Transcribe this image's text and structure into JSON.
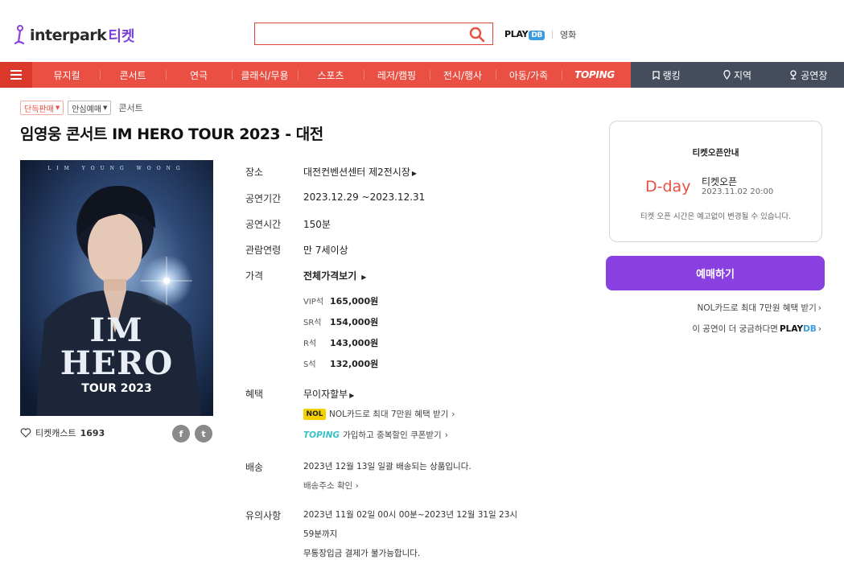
{
  "header": {
    "logo_text": "interpark",
    "logo_suffix": "티켓",
    "search_value": "",
    "playdb_label": "PLAY",
    "playdb_badge": "DB",
    "movie_label": "영화"
  },
  "nav": {
    "items": [
      "뮤지컬",
      "콘서트",
      "연극",
      "클래식/무용",
      "스포츠",
      "레저/캠핑",
      "전시/행사",
      "아동/가족",
      "TOPING"
    ],
    "right_items": [
      "랭킹",
      "지역",
      "공연장"
    ]
  },
  "tags": [
    "단독판매",
    "안심예매",
    "콘서트"
  ],
  "title": "임영웅 콘서트 IM HERO TOUR 2023 - 대전",
  "poster": {
    "top_text": "LIM YOUNG WOONG",
    "line1": "IM",
    "line2": "HERO",
    "line3": "TOUR 2023"
  },
  "like": {
    "label": "티켓캐스트",
    "count": "1693"
  },
  "social": {
    "facebook": "f",
    "twitter": "t"
  },
  "info": {
    "venue_label": "장소",
    "venue_value": "대전컨벤션센터 제2전시장",
    "period_label": "공연기간",
    "period_value": "2023.12.29 ~2023.12.31",
    "duration_label": "공연시간",
    "duration_value": "150분",
    "age_label": "관람연령",
    "age_value": "만 7세이상",
    "price_label": "가격",
    "price_all": "전체가격보기",
    "prices": [
      {
        "grade": "VIP석",
        "amount": "165,000원"
      },
      {
        "grade": "SR석",
        "amount": "154,000원"
      },
      {
        "grade": "R석",
        "amount": "143,000원"
      },
      {
        "grade": "S석",
        "amount": "132,000원"
      }
    ],
    "benefit_label": "혜택",
    "benefit_value": "무이자할부",
    "benefit_nol_badge": "NOL",
    "benefit_nol": "NOL카드로 최대 7만원 혜택 받기",
    "benefit_toping_badge": "TOPING",
    "benefit_toping": "가입하고 중복할인 쿠폰받기",
    "delivery_label": "배송",
    "delivery_value": "2023년 12월 13일 일괄 배송되는 상품입니다.",
    "delivery_link": "배송주소 확인",
    "notice_label": "유의사항",
    "notice_line1": "2023년 11월 02일 00시 00분~2023년 12월 31일 23시",
    "notice_line2": "59분까지",
    "notice_line3": "무통장입금 결제가 불가능합니다."
  },
  "open_box": {
    "title": "티켓오픈안내",
    "dday": "D-day",
    "open_label": "티켓오픈",
    "open_date": "2023.11.02 20:00",
    "note": "티켓 오픈 시간은 예고없이 변경될 수 있습니다."
  },
  "book_button": "예매하기",
  "side_links": {
    "nol": "NOL카드로 최대 7만원 혜택 받기",
    "playdb_prefix": "이 공연이 더 궁금하다면",
    "playdb_play": "PLAY",
    "playdb_db": "DB"
  }
}
